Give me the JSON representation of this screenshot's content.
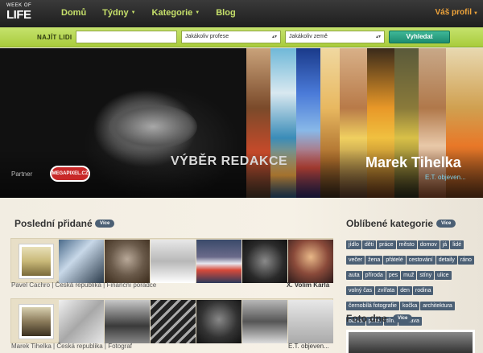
{
  "logo": {
    "small": "WEEK OF",
    "big": "LIFE"
  },
  "nav": {
    "items": [
      {
        "label": "Domů",
        "has_caret": false
      },
      {
        "label": "Týdny",
        "has_caret": true
      },
      {
        "label": "Kategorie",
        "has_caret": true
      },
      {
        "label": "Blog",
        "has_caret": false
      }
    ],
    "profile": "Váš profil"
  },
  "search": {
    "label": "NAJÍT LIDI",
    "input_value": "",
    "profession": "Jakákoliv profese",
    "country": "Jakákoliv země",
    "button": "Vyhledat"
  },
  "hero": {
    "partner_label": "Partner",
    "partner_logo": "MEGAPIXEL.CZ",
    "title": "VÝBĚR REDAKCE",
    "name": "Marek Tihelka",
    "link": "E.T. objeven..."
  },
  "latest": {
    "title": "Poslední přidané",
    "more": "Více",
    "rows": [
      {
        "meta": "Pavel Cachro | Česká republika | Finanční poradce",
        "week": "X. Volím Karla"
      },
      {
        "meta": "Marek Tihelka | Česká republika | Fotograf",
        "week": "E.T. objeven..."
      }
    ]
  },
  "favorites": {
    "title": "Oblíbené kategorie",
    "more": "Více",
    "tags": [
      "jídlo",
      "děti",
      "práce",
      "město",
      "domov",
      "já",
      "lidé",
      "večer",
      "žena",
      "přátelé",
      "cestování",
      "detaily",
      "ráno",
      "auta",
      "příroda",
      "pes",
      "muž",
      "stíny",
      "ulice",
      "volný čas",
      "zvířata",
      "den",
      "rodina",
      "černobílá fotografie",
      "kočka",
      "architektura",
      "barva",
      "přítel",
      "tílm",
      "zábava"
    ]
  },
  "photo_of_day": {
    "title": "Foto dne",
    "more": "Více"
  },
  "colors": {
    "nav_green": "#c6e06a",
    "profile_orange": "#f0a43a",
    "accent_teal": "#1d8d70",
    "tag_blue": "#4b5f74"
  }
}
